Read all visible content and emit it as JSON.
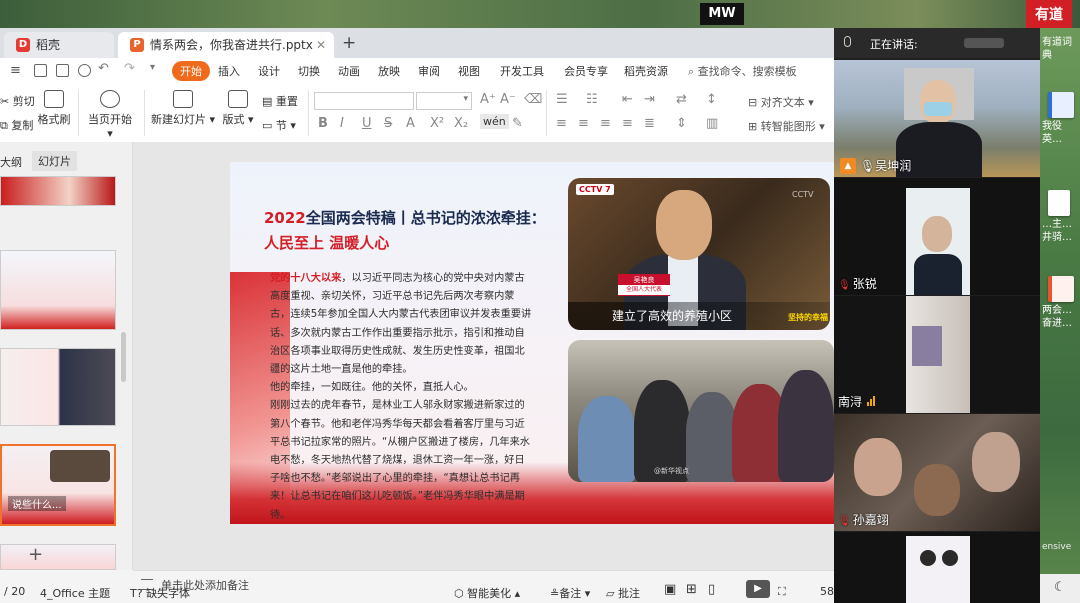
{
  "desktop": {
    "top_logo": "MW",
    "youdao_logo": "有道",
    "icons": [
      {
        "label": "有道词典"
      },
      {
        "label": "我役英…"
      },
      {
        "label": "…主…井骑…"
      },
      {
        "label": "两会…奋进…"
      }
    ],
    "tray_label": "ensive"
  },
  "tabs": [
    {
      "label": "稻壳",
      "icon": "docer-icon"
    },
    {
      "label": "情系两会，你我奋进共行.pptx",
      "icon": "ppt-icon"
    }
  ],
  "menu": {
    "items": [
      "开始",
      "插入",
      "设计",
      "切换",
      "动画",
      "放映",
      "审阅",
      "视图",
      "开发工具",
      "会员专享",
      "稻壳资源"
    ],
    "active": "开始",
    "search": "查找命令、搜索模板"
  },
  "ribbon": {
    "cut": "剪切",
    "copy": "复制",
    "format_painter": "格式刷",
    "from_current": "当页开始",
    "new_slide": "新建幻灯片",
    "layout": "版式",
    "reset": "重置",
    "section": "节",
    "text_box": "对齐文本",
    "smart_art": "转智能图形"
  },
  "left_panel": {
    "outline_tab": "大纲",
    "slides_tab": "幻灯片",
    "thumb_caption": "说些什么..."
  },
  "slide": {
    "title_year": "2022",
    "title_rest": "全国两会特稿丨总书记的浓浓牵挂：",
    "subtitle": "人民至上 温暖人心",
    "para1_lead": "党的十八大以来",
    "para1": "，以习近平同志为核心的党中央对内蒙古高度重视、亲切关怀，习近平总书记先后两次考察内蒙古，连续5年参加全国人大内蒙古代表团审议并发表重要讲话、多次就内蒙古工作作出重要指示批示，指引和推动自治区各项事业取得历史性成就、发生历史性变革，祖国北疆的这片土地一直是他的牵挂。",
    "para2": "他的牵挂，一如既往。他的关怀，直抵人心。",
    "para3": "刚刚过去的虎年春节，是林业工人邬永财家搬进新家过的第八个春节。他和老伴冯秀华每天都会看着客厅里与习近平总书记拉家常的照片。“从棚户区搬进了楼房，几年来水电不愁，冬天地热代替了烧煤，退休工资一年一涨，好日子啥也不愁。”老邬说出了心里的牵挂，“真想让总书记再来！让总书记在咱们这儿吃顿饭。”老伴冯秀华眼中满是期待。",
    "image1_logo": "CCTV 7",
    "image1_corner": "CCTV",
    "image1_name": "吴艳良",
    "image1_role": "全国人大代表",
    "image1_caption": "建立了高效的养殖小区",
    "image1_stamp": "坚持的幸福",
    "image2_watermark": "@新华视点"
  },
  "notes": {
    "placeholder": "单击此处添加备注"
  },
  "status": {
    "page": "/ 20",
    "theme": "4_Office 主题",
    "missing_fonts": "缺失字体",
    "beautify": "智能美化",
    "notes_btn": "备注",
    "comments_btn": "批注",
    "zoom": "58"
  },
  "meeting": {
    "speaking_label": "正在讲话:",
    "participants": [
      {
        "name": "吴坤润",
        "mic": "on",
        "host": true
      },
      {
        "name": "张锐",
        "mic": "off"
      },
      {
        "name": "南浔",
        "mic": "signal"
      },
      {
        "name": "孙嘉翊",
        "mic": "off"
      },
      {
        "name": "",
        "mic": "none"
      }
    ]
  },
  "colors": {
    "accent_orange": "#f06a1c",
    "title_red": "#d51d25",
    "meeting_bg": "#1f1f1f"
  }
}
